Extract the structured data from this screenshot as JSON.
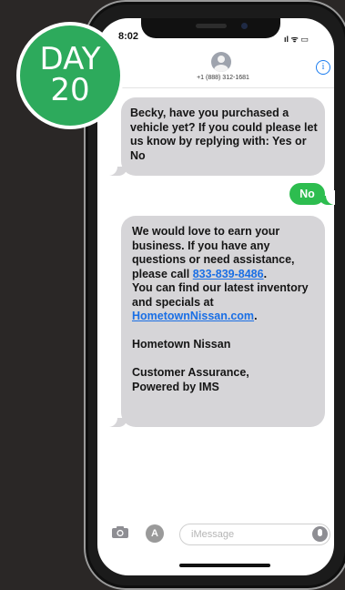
{
  "badge": {
    "line1": "DAY",
    "line2": "20"
  },
  "status_bar": {
    "time": "8:02",
    "signal": "ıl ᯤ ▭"
  },
  "header": {
    "contact_number": "+1 (888) 312-1681",
    "info_icon": "i"
  },
  "messages": {
    "m1": "Becky, have you purchased a vehicle yet? If you could please let us know by replying with: Yes or No",
    "m2": "No",
    "m3": {
      "p1": "We would love to earn your business. If you have any questions or need assistance, please call",
      "phone_link": "833-839-8486",
      "p1_end": ".",
      "p2": "You can find our latest inventory and specials at",
      "site_link": "HometownNissan.com",
      "p2_end": ".",
      "p3": "Hometown Nissan",
      "p4a": "Customer Assurance,",
      "p4b": "Powered by IMS"
    }
  },
  "composer": {
    "placeholder": "iMessage",
    "apps_icon": "A"
  },
  "colors": {
    "badge_green": "#2daa5c",
    "outgoing_bubble": "#2dbd4f",
    "incoming_bubble": "#d6d5d8",
    "link_blue": "#1a6fe5",
    "background": "#2a2726"
  }
}
